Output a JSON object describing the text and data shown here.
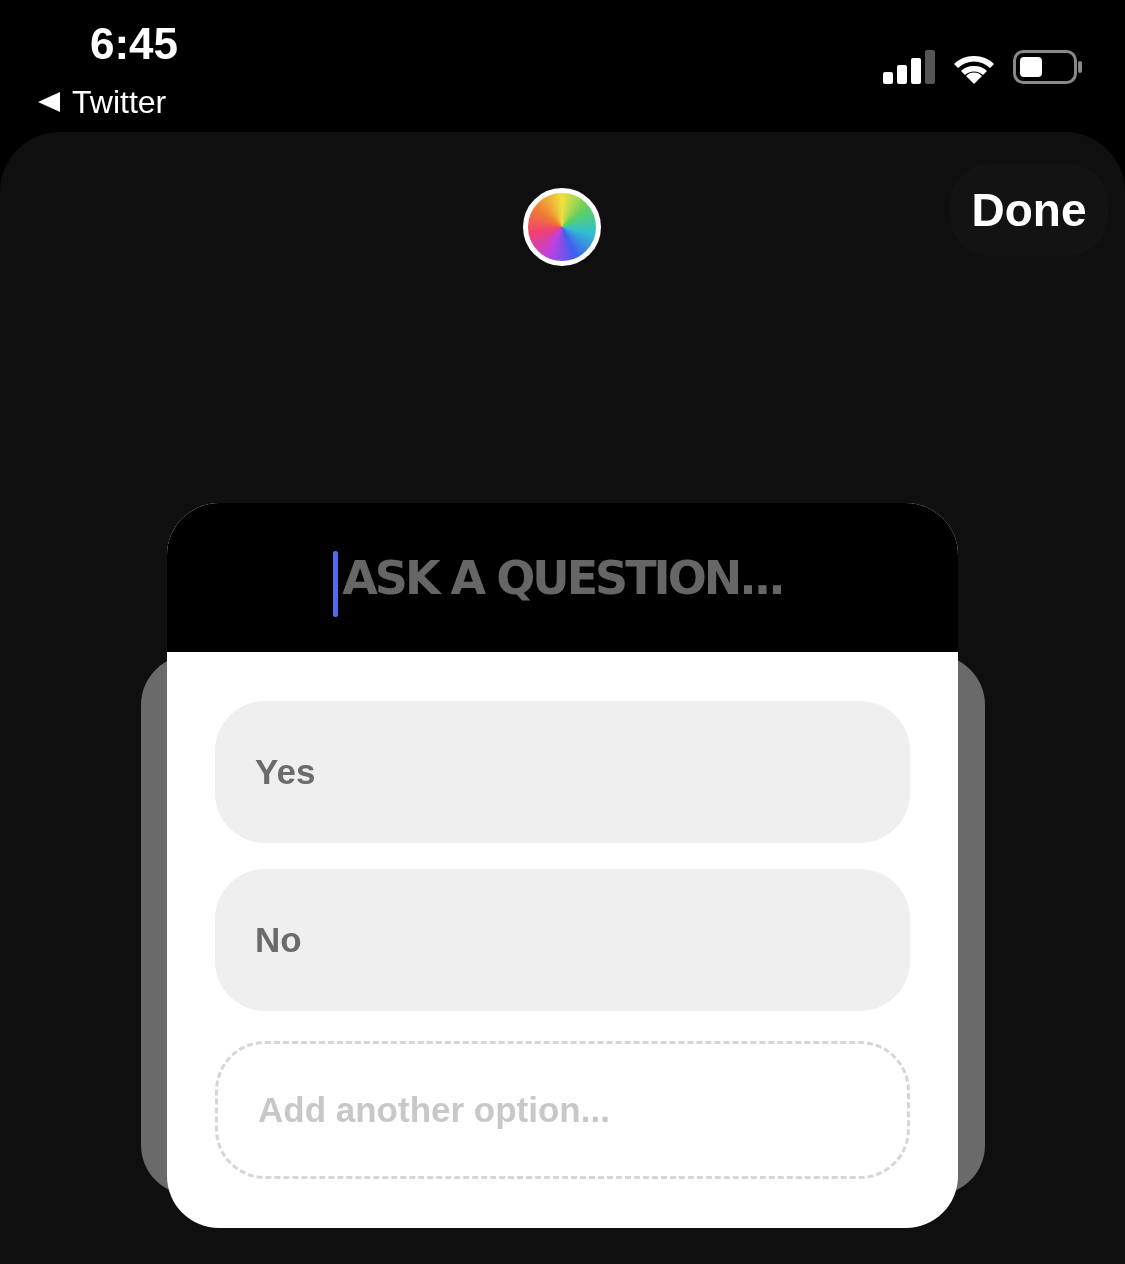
{
  "status_bar": {
    "time": "6:45",
    "back_label": "Twitter"
  },
  "done_button": {
    "label": "Done"
  },
  "question": {
    "placeholder": "ASK A QUESTION...",
    "focused": true
  },
  "options": [
    {
      "placeholder": "Yes"
    },
    {
      "placeholder": "No"
    }
  ],
  "add_option": {
    "placeholder": "Add another option..."
  }
}
